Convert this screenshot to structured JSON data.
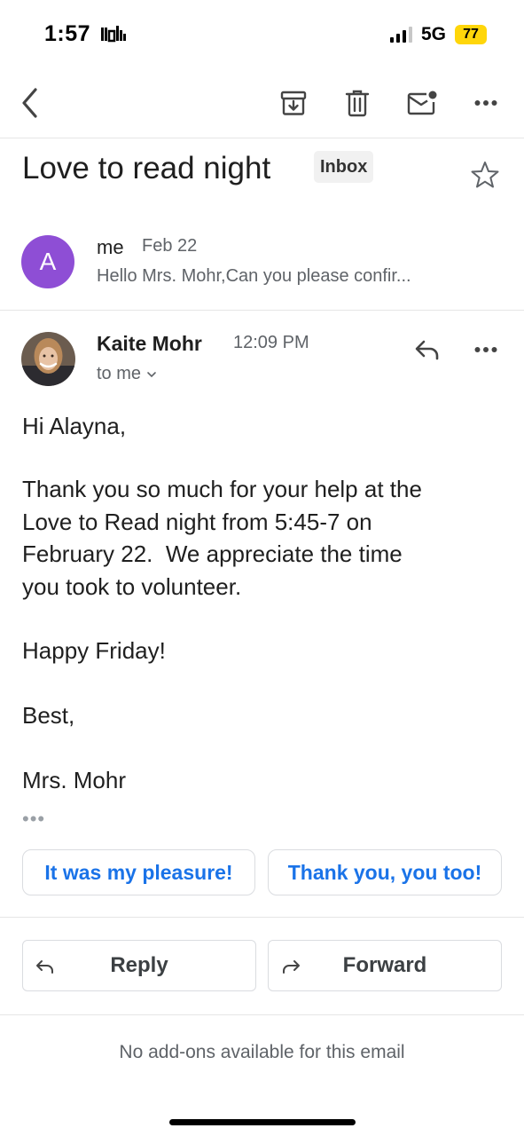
{
  "status_bar": {
    "time": "1:57",
    "network": "5G",
    "battery": "77"
  },
  "email": {
    "subject": "Love to read night",
    "label": "Inbox"
  },
  "collapsed_message": {
    "avatar_letter": "A",
    "sender": "me",
    "date": "Feb 22",
    "snippet": "Hello Mrs. Mohr,Can you please confir..."
  },
  "message": {
    "sender": "Kaite Mohr",
    "time": "12:09 PM",
    "recipients": "to me",
    "greeting": "Hi Alayna,",
    "paragraph1_line1": "Thank you so much for your help at the",
    "paragraph1_line2": "Love to Read night from 5:45-7 on",
    "paragraph1_line3": "February 22.  We appreciate the time",
    "paragraph1_line4": "you took to volunteer.",
    "paragraph2": "Happy Friday!",
    "closing": "Best,",
    "signature": "Mrs. Mohr",
    "trimmed": "•••"
  },
  "smart_replies": [
    "It was my pleasure!",
    "Thank you, you too!"
  ],
  "actions": {
    "reply": "Reply",
    "forward": "Forward"
  },
  "footer": {
    "addons": "No add-ons available for this email"
  },
  "colors": {
    "accent": "#1a73e8",
    "avatar": "#8e4ed5",
    "battery": "#ffd60a"
  }
}
